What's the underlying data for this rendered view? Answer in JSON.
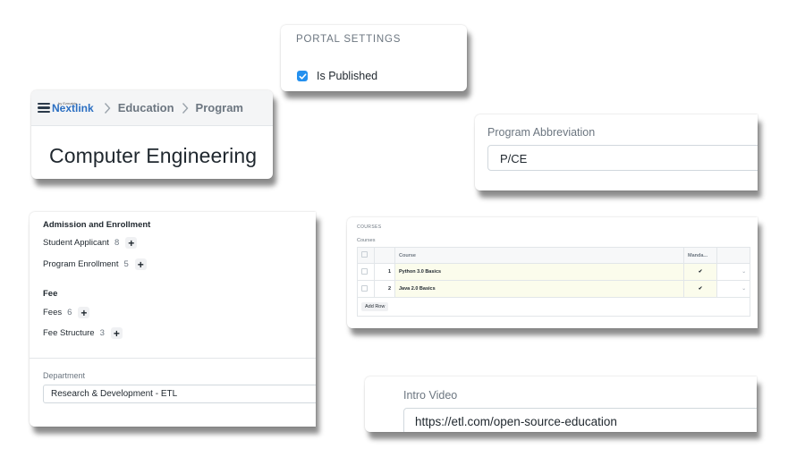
{
  "portal_settings": {
    "section_title": "PORTAL SETTINGS",
    "is_published_label": "Is Published",
    "is_published_checked": true
  },
  "header": {
    "logo_text": "Nextlink",
    "logo_subtext": "by Ezmatrix",
    "breadcrumbs": [
      "Education",
      "Program"
    ],
    "page_title": "Computer Engineering"
  },
  "program_abbreviation": {
    "label": "Program Abbreviation",
    "value": "P/CE"
  },
  "connections": {
    "groups": [
      {
        "title": "Admission and Enrollment",
        "links": [
          {
            "label": "Student Applicant",
            "count": "8"
          },
          {
            "label": "Program Enrollment",
            "count": "5"
          }
        ]
      },
      {
        "title": "Fee",
        "links": [
          {
            "label": "Fees",
            "count": "6"
          },
          {
            "label": "Fee Structure",
            "count": "3"
          }
        ]
      }
    ],
    "plus_symbol": "+"
  },
  "department": {
    "label": "Department",
    "value": "Research & Development - ETL"
  },
  "courses": {
    "section_title": "COURSES",
    "label": "Courses",
    "columns": [
      "Course",
      "Manda..."
    ],
    "rows": [
      {
        "idx": "1",
        "course": "Python 3.0 Basics",
        "mandatory": "✔"
      },
      {
        "idx": "2",
        "course": "Java 2.0 Basics",
        "mandatory": "✔"
      }
    ],
    "add_row_label": "Add Row"
  },
  "intro_video": {
    "label": "Intro Video",
    "value": "https://etl.com/open-source-education"
  },
  "colors": {
    "accent": "#2490ef",
    "brand_blue": "#2b6fc2",
    "muted_text": "#6c7680",
    "row_highlight": "#fbfcec"
  }
}
